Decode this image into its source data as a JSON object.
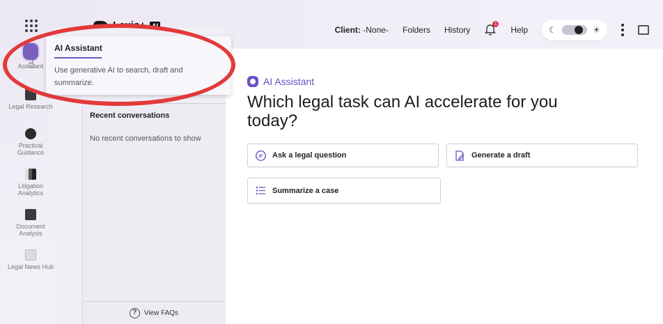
{
  "topbar": {
    "brand": "Lexis+",
    "brand_tag": "AI",
    "client_label": "Client:",
    "client_value": "-None-",
    "folders": "Folders",
    "history": "History",
    "notifications_count": "1",
    "help": "Help"
  },
  "rail": {
    "items": [
      {
        "label": "Assistant",
        "icon": "ai-assistant-icon"
      },
      {
        "label": "Legal Research",
        "icon": "legal-research-icon"
      },
      {
        "label": "Practical Guidance",
        "icon": "practical-guidance-icon"
      },
      {
        "label": "Litigation Analytics",
        "icon": "bar-chart-icon"
      },
      {
        "label": "Document Analysis",
        "icon": "document-analysis-icon"
      },
      {
        "label": "Legal News Hub",
        "icon": "news-icon"
      }
    ]
  },
  "tooltip": {
    "title": "AI Assistant",
    "text": "Use generative AI to search, draft and summarize."
  },
  "panel": {
    "recent_title": "Recent conversations",
    "recent_empty": "No recent conversations to show",
    "faq": "View FAQs"
  },
  "main": {
    "label": "AI Assistant",
    "heading": "Which legal task can AI accelerate for you today?",
    "tasks": [
      {
        "label": "Ask a legal question",
        "icon": "chat-question-icon"
      },
      {
        "label": "Generate a draft",
        "icon": "edit-document-icon"
      },
      {
        "label": "Summarize a case",
        "icon": "list-icon"
      }
    ]
  },
  "colors": {
    "accent": "#6a4fc0",
    "annotation": "#e23a3a"
  }
}
